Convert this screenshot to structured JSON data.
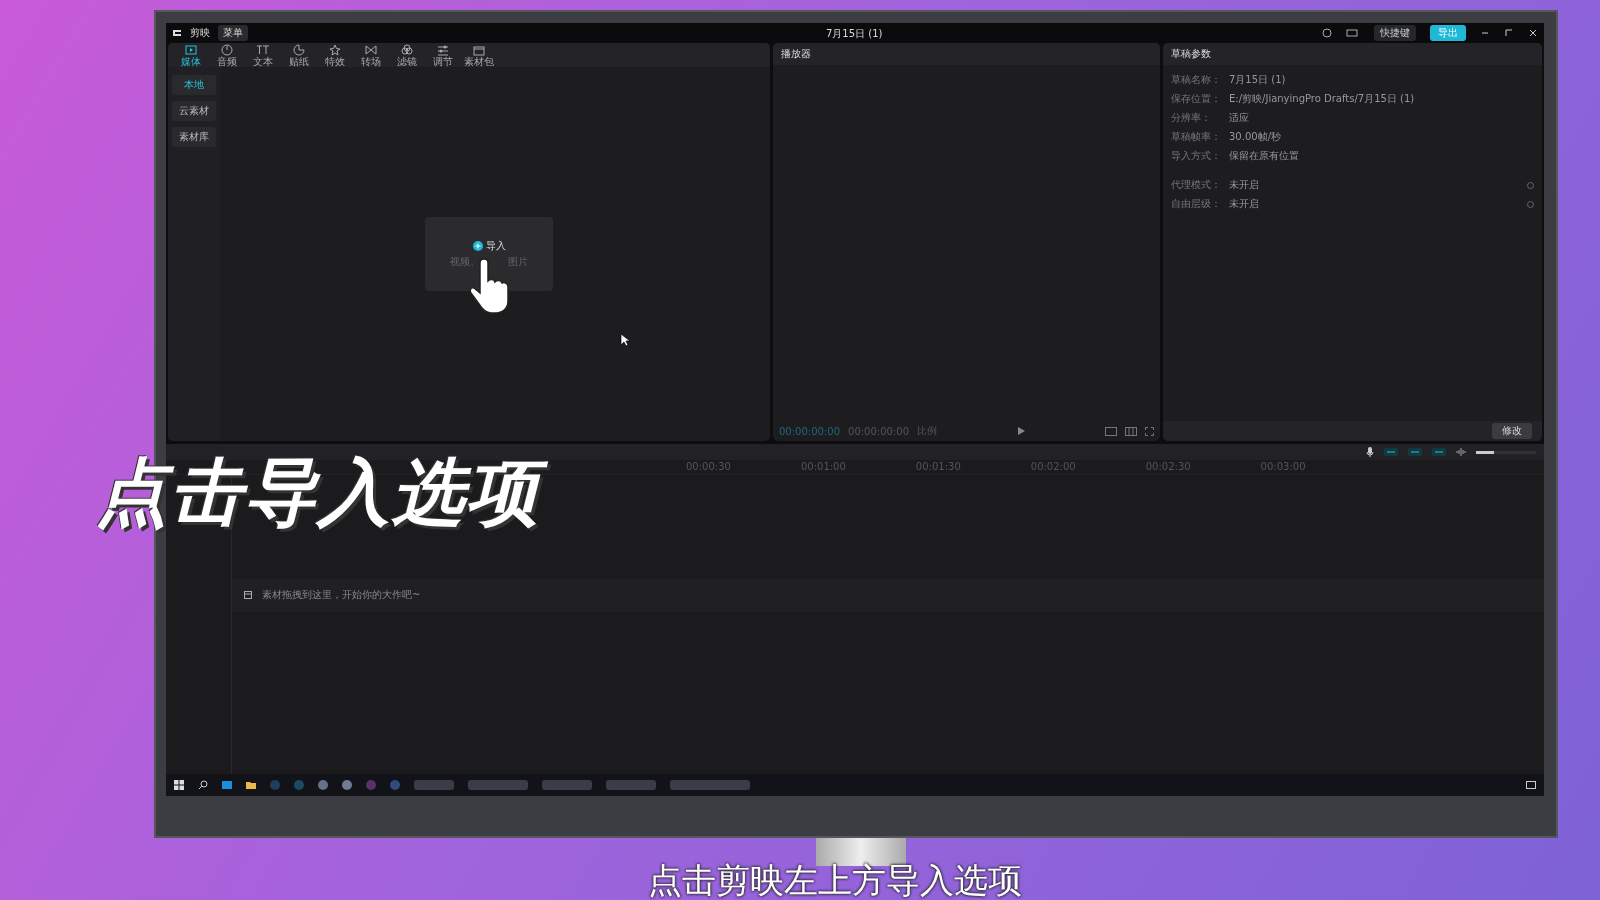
{
  "app": {
    "title": "剪映",
    "menu_button": "菜单",
    "project_title": "7月15日 (1)",
    "shortcut_button": "快捷键",
    "export_button": "导出"
  },
  "toolbar": [
    {
      "label": "媒体",
      "selected": true
    },
    {
      "label": "音频",
      "selected": false
    },
    {
      "label": "文本",
      "selected": false
    },
    {
      "label": "贴纸",
      "selected": false
    },
    {
      "label": "特效",
      "selected": false
    },
    {
      "label": "转场",
      "selected": false
    },
    {
      "label": "滤镜",
      "selected": false
    },
    {
      "label": "调节",
      "selected": false
    },
    {
      "label": "素材包",
      "selected": false
    }
  ],
  "sidebar": [
    {
      "label": "本地",
      "selected": true
    },
    {
      "label": "云素材",
      "selected": false
    },
    {
      "label": "素材库",
      "selected": false
    }
  ],
  "import_card": {
    "label": "导入",
    "hint_left": "视频、",
    "hint_right": "图片"
  },
  "player": {
    "title": "播放器",
    "timecode": "00:00:00:00",
    "duration": "00:00:00:00",
    "ratio": "比例"
  },
  "params": {
    "title": "草稿参数",
    "rows": [
      {
        "label": "草稿名称：",
        "value": "7月15日 (1)"
      },
      {
        "label": "保存位置：",
        "value": "E:/剪映/JianyingPro Drafts/7月15日 (1)"
      },
      {
        "label": "分辨率：",
        "value": "适应"
      },
      {
        "label": "草稿帧率：",
        "value": "30.00帧/秒"
      },
      {
        "label": "导入方式：",
        "value": "保留在原有位置"
      },
      {
        "label": "代理模式：",
        "value": "未开启"
      },
      {
        "label": "自由层级：",
        "value": "未开启"
      }
    ],
    "modify_button": "修改"
  },
  "timeline": {
    "zoom_slider": {
      "level": 0.3
    },
    "ticks": [
      "00:00:30",
      "00:01:00",
      "00:01:30",
      "00:02:00",
      "00:02:30",
      "00:03:00"
    ],
    "hint": "素材拖拽到这里，开始你的大作吧~"
  },
  "captions": {
    "overlay_title": "点击导入选项",
    "subtitle": "点击剪映左上方导入选项"
  }
}
